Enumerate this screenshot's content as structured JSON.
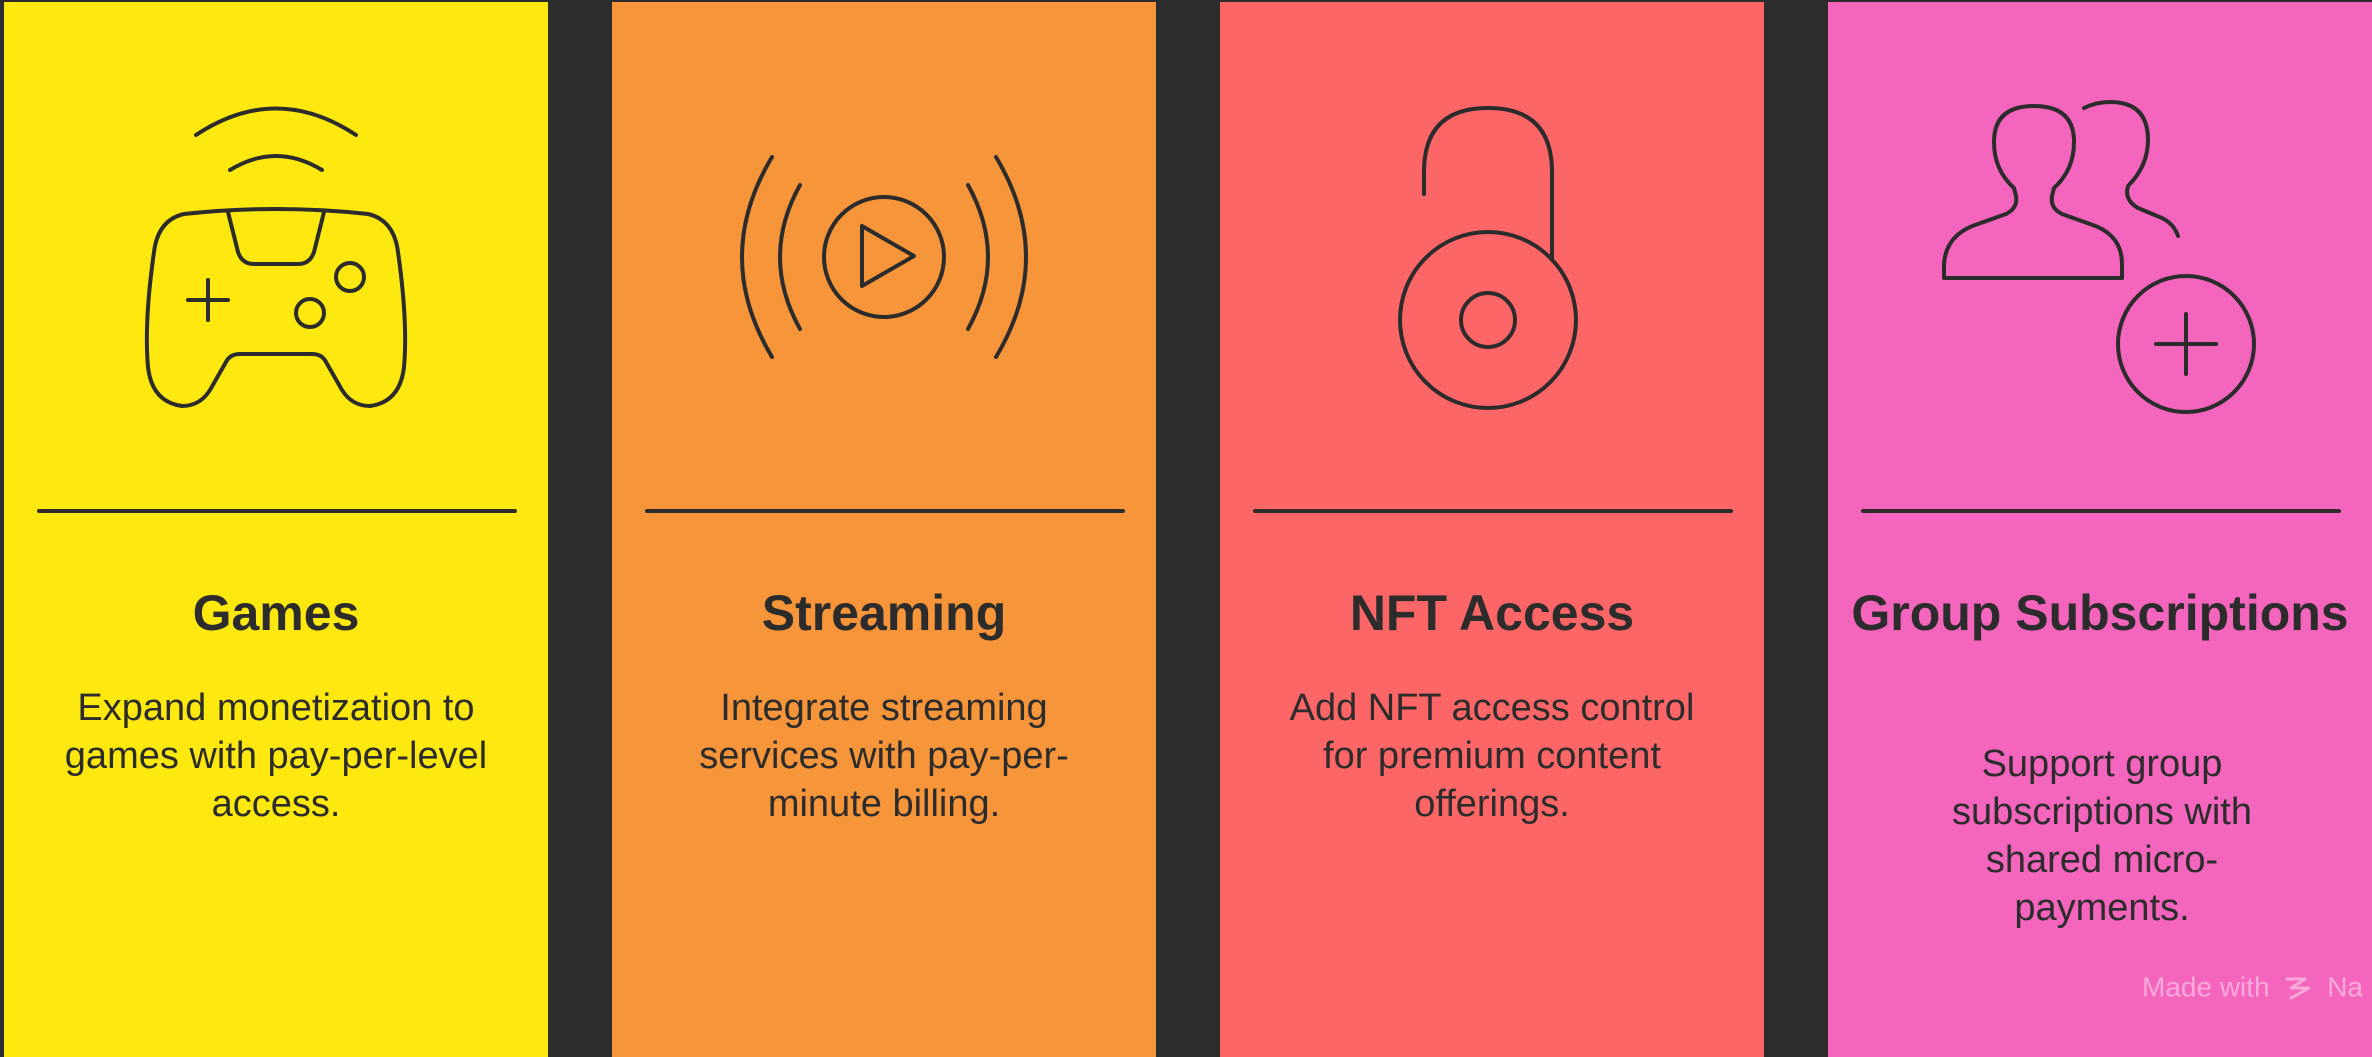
{
  "cards": [
    {
      "title": "Games",
      "description": "Expand monetization to games with pay-per-level access.",
      "color": "#fde910",
      "icon": "gamepad-icon"
    },
    {
      "title": "Streaming",
      "description": "Integrate streaming services with pay-per-minute billing.",
      "color": "#f69539",
      "icon": "broadcast-play-icon"
    },
    {
      "title": "NFT Access",
      "description": "Add NFT access control for premium content offerings.",
      "color": "#fd6666",
      "icon": "unlocked-padlock-icon"
    },
    {
      "title": "Group Subscriptions",
      "description": "Support group subscriptions with shared micro-payments.",
      "color": "#f465bd",
      "icon": "add-users-icon"
    }
  ],
  "watermark": {
    "text_prefix": "Made with",
    "brand": "Na"
  },
  "colors": {
    "background": "#2c2c2c",
    "stroke": "#2c2c2c"
  }
}
